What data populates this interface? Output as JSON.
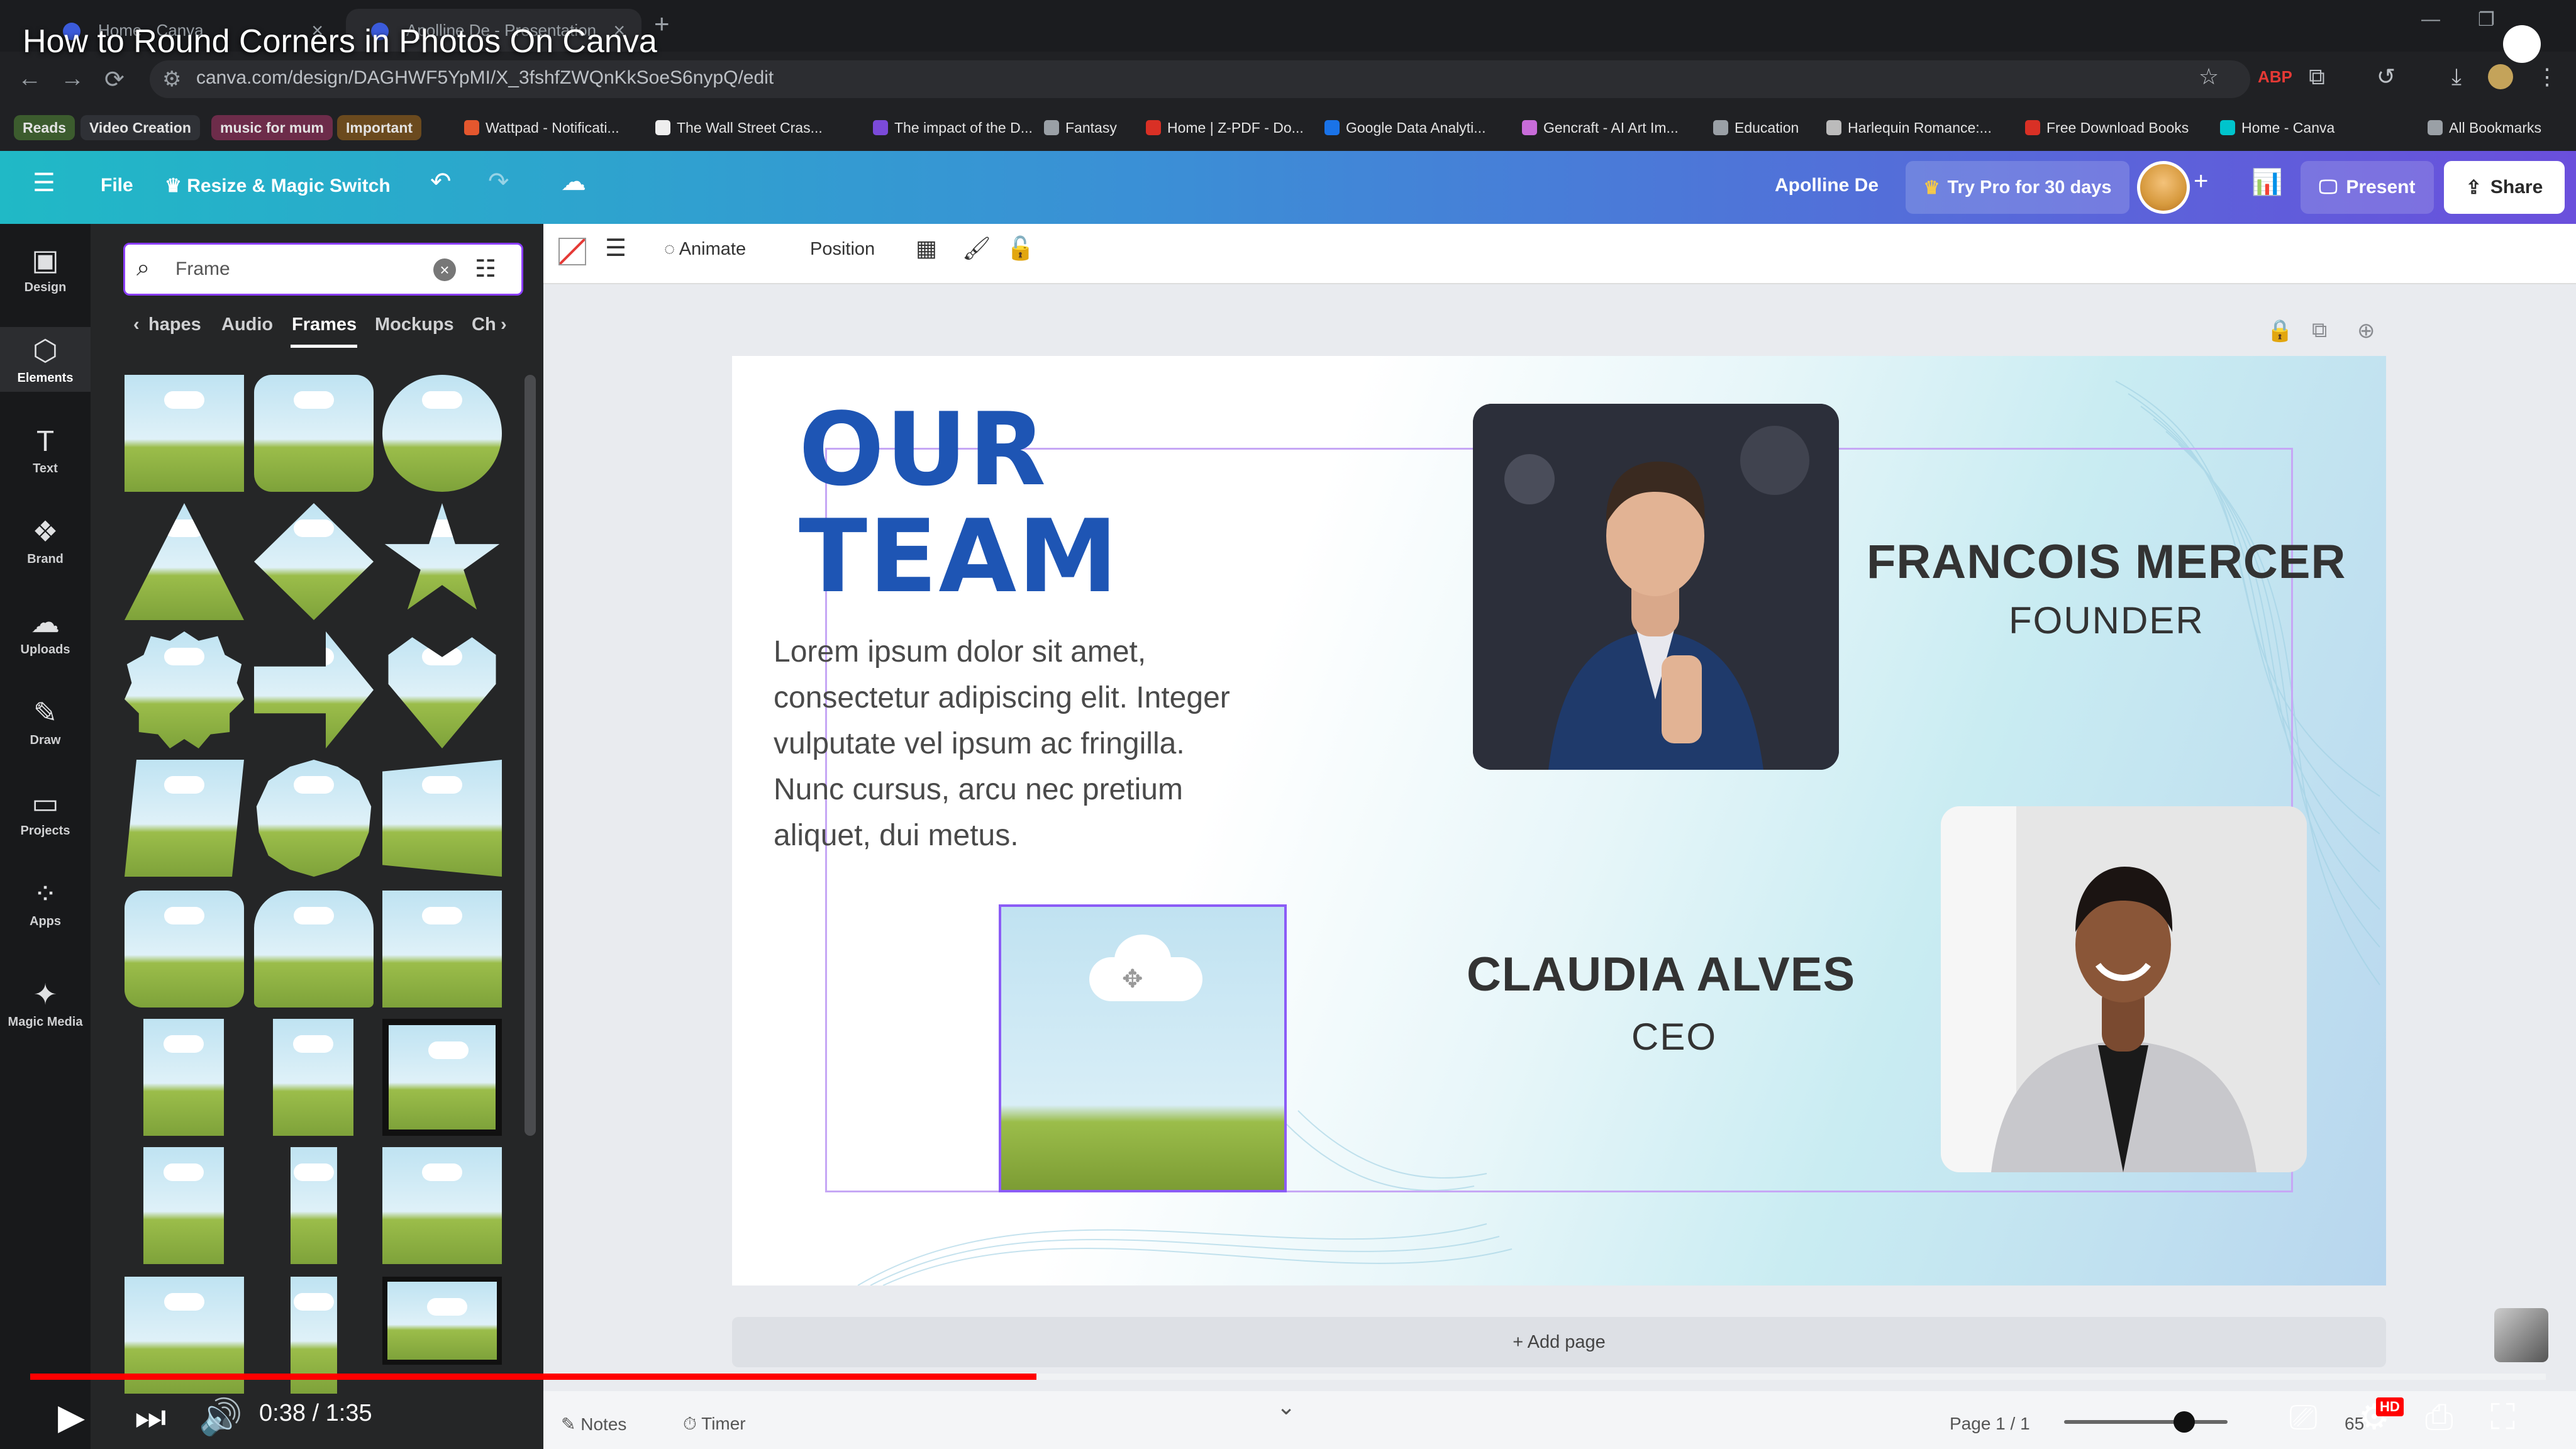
{
  "video": {
    "title": "How to Round Corners in Photos On Canva",
    "time_current": "0:38",
    "time_total": "1:35",
    "progress": 0.4,
    "badge": "HD"
  },
  "browser": {
    "tabs": [
      {
        "label": "Home - Canva"
      },
      {
        "label": "Apolline De - Presentation"
      }
    ],
    "url": "canva.com/design/DAGHWF5YpMI/X_3fshfZWQnKkSoeS6nypQ/edit",
    "bookmarks": [
      {
        "label": "Reads",
        "style": "chip",
        "color": "#3c5c2e"
      },
      {
        "label": "Video Creation",
        "style": "chip",
        "color": "#2f3136"
      },
      {
        "label": "music for mum",
        "style": "chip",
        "color": "#6d2c4a"
      },
      {
        "label": "Important",
        "style": "chip",
        "color": "#6b4a1e"
      },
      {
        "label": "Wattpad - Notificati...",
        "color": "#e4572e"
      },
      {
        "label": "The Wall Street Cras...",
        "color": "#eeeeee"
      },
      {
        "label": "The impact of the D...",
        "color": "#7b4ad9"
      },
      {
        "label": "Fantasy",
        "color": "#9aa0a6"
      },
      {
        "label": "Home | Z-PDF - Do...",
        "color": "#d93025"
      },
      {
        "label": "Google Data Analyti...",
        "color": "#1a73e8"
      },
      {
        "label": "Gencraft - AI Art Im...",
        "color": "#c86cd9"
      },
      {
        "label": "Education",
        "color": "#9aa0a6"
      },
      {
        "label": "Harlequin Romance:...",
        "color": "#bbbbbb"
      },
      {
        "label": "Free Download Books",
        "color": "#d93025"
      },
      {
        "label": "Home - Canva",
        "color": "#00c4cc"
      },
      {
        "label": "All Bookmarks",
        "color": "#9aa0a6"
      }
    ]
  },
  "canva_header": {
    "menu_icon": "hamburger-icon",
    "file": "File",
    "resize": "Resize & Magic Switch",
    "user": "Apolline De",
    "try_pro": "Try Pro for 30 days",
    "present": "Present",
    "share": "Share"
  },
  "rail": [
    {
      "label": "Design",
      "icon": "design-icon"
    },
    {
      "label": "Elements",
      "icon": "elements-icon",
      "active": true
    },
    {
      "label": "Text",
      "icon": "text-icon"
    },
    {
      "label": "Brand",
      "icon": "brand-icon"
    },
    {
      "label": "Uploads",
      "icon": "uploads-icon"
    },
    {
      "label": "Draw",
      "icon": "draw-icon"
    },
    {
      "label": "Projects",
      "icon": "projects-icon"
    },
    {
      "label": "Apps",
      "icon": "apps-icon"
    },
    {
      "label": "Magic Media",
      "icon": "magic-media-icon"
    }
  ],
  "panel": {
    "search_value": "Frame",
    "categories": [
      "hapes",
      "Audio",
      "Frames",
      "Mockups",
      "Ch"
    ],
    "active_category": "Frames"
  },
  "toolbar": {
    "animate": "Animate",
    "position": "Position"
  },
  "slide": {
    "heading_line1": "OUR",
    "heading_line2": "TEAM",
    "body": "Lorem ipsum dolor sit amet, consectetur adipiscing elit. Integer vulputate vel ipsum ac fringilla. Nunc cursus, arcu nec pretium aliquet, dui metus.",
    "person1_name": "FRANCOIS MERCER",
    "person1_role": "FOUNDER",
    "person2_name": "CLAUDIA ALVES",
    "person2_role": "CEO"
  },
  "editor": {
    "add_page": "+ Add page",
    "notes": "Notes",
    "timer": "Timer",
    "page_info": "Page 1 / 1",
    "zoom": "65"
  }
}
